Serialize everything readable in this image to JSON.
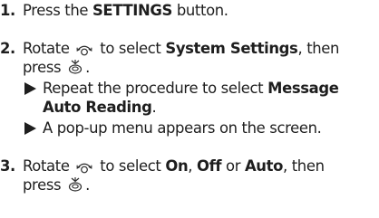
{
  "steps": [
    {
      "number": "1.",
      "lines": [
        {
          "before": "Press the ",
          "bold": "SETTINGS",
          "after": " button."
        }
      ]
    },
    {
      "number": "2.",
      "line1": {
        "before": "Rotate ",
        "after_icon": " to select ",
        "bold": "System Settings",
        "after": ", then"
      },
      "line2": {
        "before": "press ",
        "after": "."
      },
      "substeps": [
        {
          "text": "Repeat the procedure to select ",
          "bold_1": "Message",
          "bold_2": "Auto Reading",
          "after": "."
        },
        {
          "text": "A pop-up menu appears on the screen."
        }
      ]
    },
    {
      "number": "3.",
      "line1": {
        "before": "Rotate ",
        "after_icon": " to select ",
        "opt1": "On",
        "sep1": ", ",
        "opt2": "Off",
        "sep2": " or ",
        "opt3": "Auto",
        "after": ", then"
      },
      "line2": {
        "before": "press ",
        "after": "."
      }
    }
  ],
  "icons": {
    "rotate": "interface-dial-rotate-icon",
    "press": "interface-dial-press-icon"
  }
}
